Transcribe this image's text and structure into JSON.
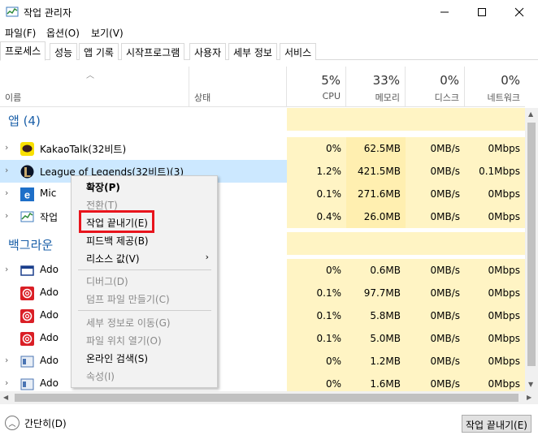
{
  "window": {
    "title": "작업 관리자"
  },
  "menu": [
    "파일(F)",
    "옵션(O)",
    "보기(V)"
  ],
  "tabs": [
    "프로세스",
    "성능",
    "앱 기록",
    "시작프로그램",
    "사용자",
    "세부 정보",
    "서비스"
  ],
  "columns": {
    "name": "이름",
    "status": "상태",
    "cpu": {
      "pct": "5%",
      "label": "CPU"
    },
    "memory": {
      "pct": "33%",
      "label": "메모리"
    },
    "disk": {
      "pct": "0%",
      "label": "디스크"
    },
    "network": {
      "pct": "0%",
      "label": "네트워크"
    }
  },
  "groups": {
    "apps": "앱 (4)",
    "background": "백그라운"
  },
  "rows": [
    {
      "name": "KakaoTalk(32비트)",
      "cpu": "0%",
      "mem": "62.5MB",
      "disk": "0MB/s",
      "net": "0Mbps",
      "icon": "kakaotalk-icon"
    },
    {
      "name": "League of Legends(32비트)(3)",
      "cpu": "1.2%",
      "mem": "421.5MB",
      "disk": "0MB/s",
      "net": "0.1Mbps",
      "icon": "league-icon"
    },
    {
      "name": "Mic",
      "cpu": "0.1%",
      "mem": "271.6MB",
      "disk": "0MB/s",
      "net": "0Mbps",
      "icon": "edge-icon"
    },
    {
      "name": "작업",
      "cpu": "0.4%",
      "mem": "26.0MB",
      "disk": "0MB/s",
      "net": "0Mbps",
      "icon": "task-manager-icon"
    },
    {
      "name": "Ado",
      "cpu": "0%",
      "mem": "0.6MB",
      "disk": "0MB/s",
      "net": "0Mbps",
      "icon": "window-icon"
    },
    {
      "name": "Ado",
      "cpu": "0.1%",
      "mem": "97.7MB",
      "disk": "0MB/s",
      "net": "0Mbps",
      "icon": "adobe-cc-icon"
    },
    {
      "name": "Ado",
      "cpu": "0.1%",
      "mem": "5.8MB",
      "disk": "0MB/s",
      "net": "0Mbps",
      "icon": "adobe-cc-icon"
    },
    {
      "name": "Ado",
      "cpu": "0.1%",
      "mem": "5.0MB",
      "disk": "0MB/s",
      "net": "0Mbps",
      "icon": "adobe-cc-icon"
    },
    {
      "name": "Ado",
      "cpu": "0%",
      "mem": "1.2MB",
      "disk": "0MB/s",
      "net": "0Mbps",
      "icon": "service-icon"
    },
    {
      "name": "Ado",
      "cpu": "0%",
      "mem": "1.6MB",
      "disk": "0MB/s",
      "net": "0Mbps",
      "icon": "service-icon"
    }
  ],
  "context_menu": {
    "expand": "확장(P)",
    "switch_to": "전환(T)",
    "end_task": "작업 끝내기(E)",
    "feedback": "피드백 제공(B)",
    "resource_values": "리소스 값(V)",
    "debug": "디버그(D)",
    "create_dump": "덤프 파일 만들기(C)",
    "go_to_details": "세부 정보로 이동(G)",
    "open_file_location": "파일 위치 열기(O)",
    "search_online": "온라인 검색(S)",
    "properties": "속성(I)"
  },
  "footer": {
    "fewer_details": "간단히(D)",
    "end_task_button": "작업 끝내기(E)"
  }
}
